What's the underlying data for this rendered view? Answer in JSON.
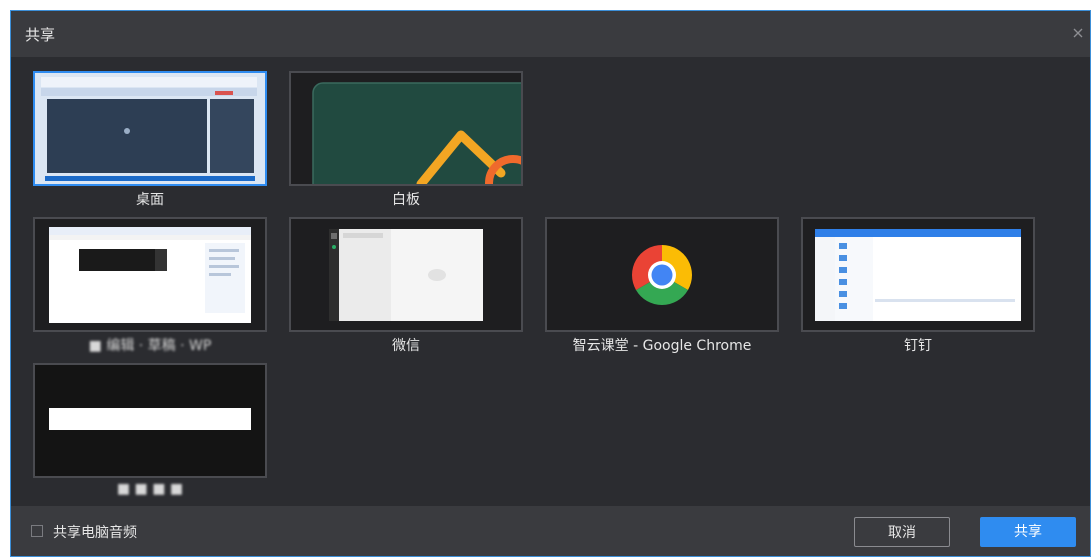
{
  "dialog": {
    "title": "共享"
  },
  "sources": [
    {
      "label": "桌面",
      "selected": true
    },
    {
      "label": "白板",
      "selected": false
    },
    {
      "label": "■ 编辑 · 草稿 · WP",
      "selected": false
    },
    {
      "label": "微信",
      "selected": false
    },
    {
      "label": "智云课堂 - Google Chrome",
      "selected": false
    },
    {
      "label": "钉钉",
      "selected": false
    },
    {
      "label": "■ ■ ■ ■",
      "selected": false
    }
  ],
  "footer": {
    "share_audio_label": "共享电脑音频",
    "share_audio_checked": false,
    "cancel_label": "取消",
    "share_label": "共享"
  },
  "colors": {
    "accent": "#2f8cf0",
    "dialog_bg": "#2b2c30",
    "bar_bg": "#3a3b3f",
    "whiteboard_bg": "#214a40",
    "chrome_red": "#ea4335",
    "chrome_yellow": "#fbbc05",
    "chrome_green": "#34a853",
    "chrome_blue": "#4285f4"
  }
}
